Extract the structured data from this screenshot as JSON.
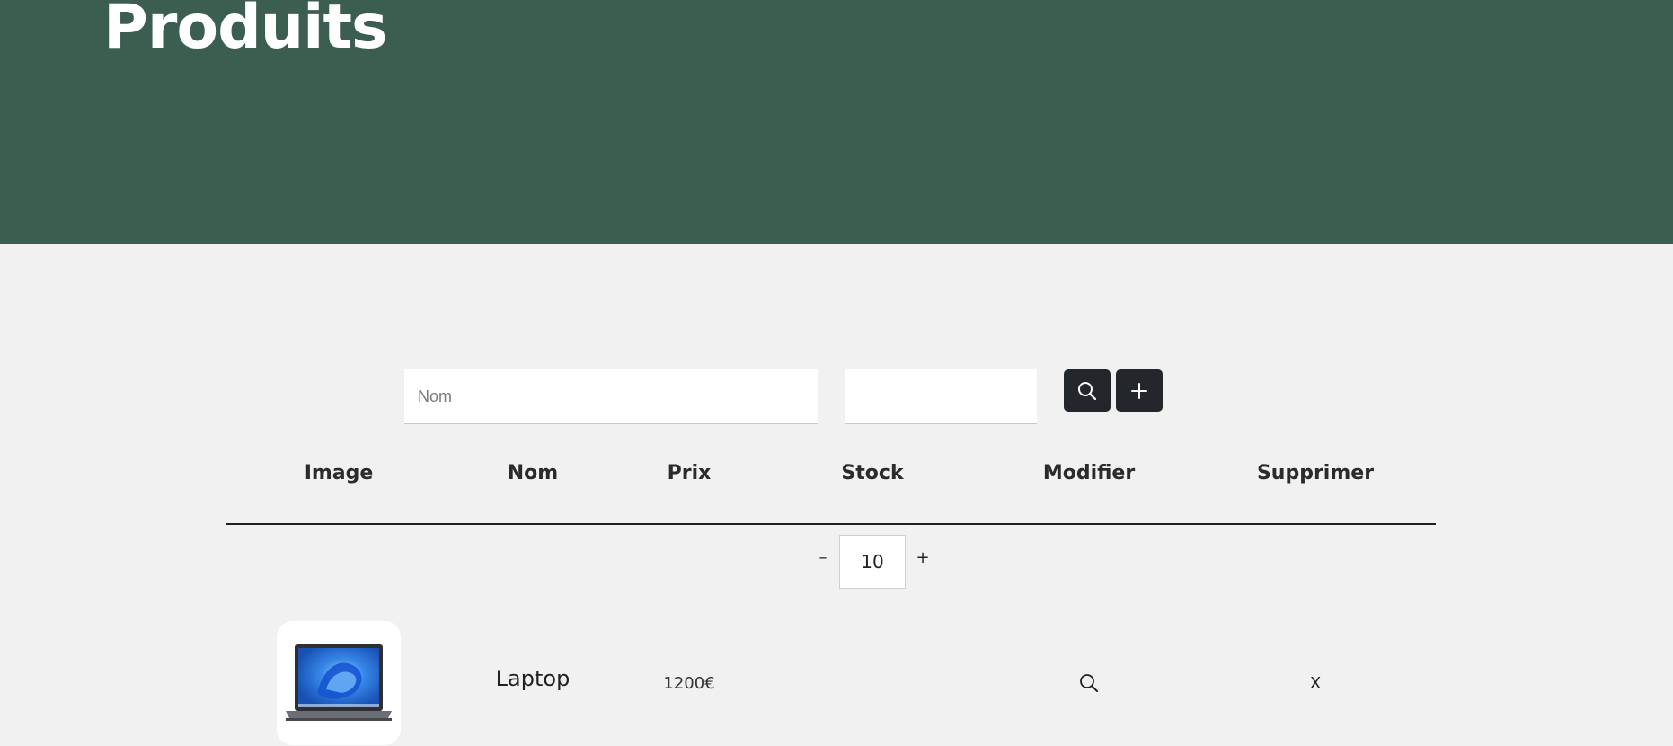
{
  "header": {
    "title": "Produits",
    "background_color": "#3c5e51"
  },
  "filters": {
    "name_placeholder": "Nom",
    "name_value": "",
    "price_placeholder": "",
    "price_value": "",
    "search_icon": "search-icon",
    "add_icon": "plus-icon",
    "button_color": "#23272b"
  },
  "table": {
    "headers": [
      "Image",
      "Nom",
      "Prix",
      "Stock",
      "Modifier",
      "Supprimer"
    ],
    "page_size": {
      "decrement_label": "–",
      "value": "10",
      "increment_label": "+"
    },
    "rows": [
      {
        "image": "laptop-image",
        "name": "Laptop",
        "price": "1200€",
        "stock": "",
        "edit_icon": "search-icon",
        "delete_label": "X"
      }
    ]
  }
}
